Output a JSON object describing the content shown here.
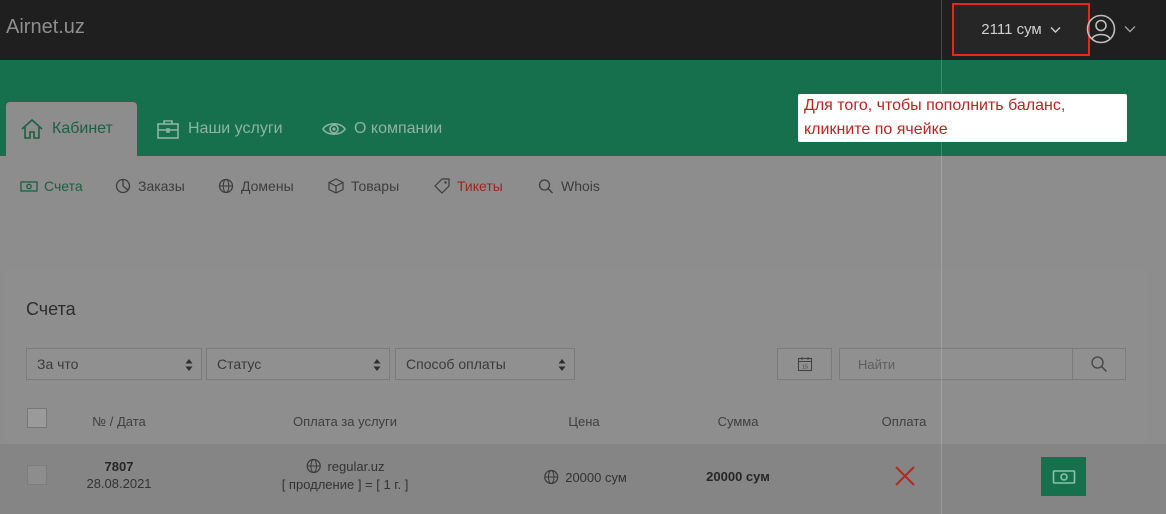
{
  "header": {
    "brand": "Airnet.uz",
    "balance": "2111 сум"
  },
  "tabs": [
    {
      "label": "Кабинет",
      "icon": "home-icon",
      "active": true
    },
    {
      "label": "Наши услуги",
      "icon": "briefcase-icon",
      "active": false
    },
    {
      "label": "О компании",
      "icon": "eye-icon",
      "active": false
    }
  ],
  "tooltip": {
    "line1": "Для того, чтобы пополнить баланс,",
    "line2": "кликните по ячейке"
  },
  "subnav": [
    {
      "label": "Счета",
      "icon": "money-icon",
      "state": "active"
    },
    {
      "label": "Заказы",
      "icon": "pie-chart-icon",
      "state": "normal"
    },
    {
      "label": "Домены",
      "icon": "globe-icon",
      "state": "normal"
    },
    {
      "label": "Товары",
      "icon": "box-icon",
      "state": "normal"
    },
    {
      "label": "Тикеты",
      "icon": "tag-icon",
      "state": "alert"
    },
    {
      "label": "Whois",
      "icon": "search-icon",
      "state": "normal"
    }
  ],
  "panel": {
    "title": "Счета",
    "filters": [
      "За что",
      "Статус",
      "Способ оплаты"
    ],
    "search_placeholder": "Найти",
    "calendar_day": "15",
    "columns": [
      "№ / Дата",
      "Оплата за услуги",
      "Цена",
      "Сумма",
      "Оплата"
    ]
  },
  "rows": [
    {
      "number": "7807",
      "date": "28.08.2021",
      "service": "regular.uz",
      "service_detail": "[ продление ] = [ 1 г. ]",
      "price": "20000 сум",
      "sum": "20000 сум",
      "paid": false
    }
  ],
  "colors": {
    "accent_green": "#16704d",
    "highlight_red": "#e3281e"
  }
}
